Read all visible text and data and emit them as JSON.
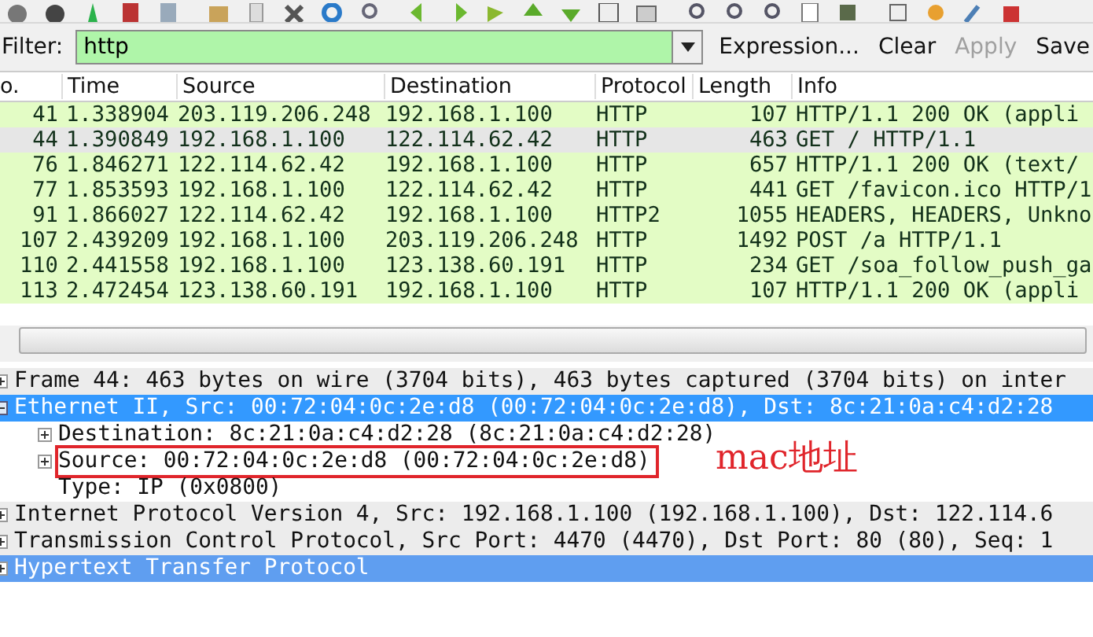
{
  "filter": {
    "label": "Filter:",
    "value": "http",
    "buttons": [
      {
        "label": "Expression...",
        "disabled": false
      },
      {
        "label": "Clear",
        "disabled": false
      },
      {
        "label": "Apply",
        "disabled": true
      },
      {
        "label": "Save",
        "disabled": false
      }
    ]
  },
  "packet_list": {
    "columns": [
      "o.",
      "Time",
      "Source",
      "Destination",
      "Protocol",
      "Length",
      "Info"
    ],
    "rows": [
      {
        "cells": [
          "41",
          "1.338904",
          "203.119.206.248",
          "192.168.1.100",
          "HTTP",
          "107",
          "HTTP/1.1 200 OK  (appli"
        ],
        "selected": false
      },
      {
        "cells": [
          "44",
          "1.390849",
          "192.168.1.100",
          "122.114.62.42",
          "HTTP",
          "463",
          "GET / HTTP/1.1"
        ],
        "selected": true
      },
      {
        "cells": [
          "76",
          "1.846271",
          "122.114.62.42",
          "192.168.1.100",
          "HTTP",
          "657",
          "HTTP/1.1 200 OK  (text/"
        ],
        "selected": false
      },
      {
        "cells": [
          "77",
          "1.853593",
          "192.168.1.100",
          "122.114.62.42",
          "HTTP",
          "441",
          "GET /favicon.ico HTTP/1"
        ],
        "selected": false
      },
      {
        "cells": [
          "91",
          "1.866027",
          "122.114.62.42",
          "192.168.1.100",
          "HTTP2",
          "1055",
          "HEADERS, HEADERS, Unkno"
        ],
        "selected": false
      },
      {
        "cells": [
          "107",
          "2.439209",
          "192.168.1.100",
          "203.119.206.248",
          "HTTP",
          "1492",
          "POST /a HTTP/1.1"
        ],
        "selected": false
      },
      {
        "cells": [
          "110",
          "2.441558",
          "192.168.1.100",
          "123.138.60.191",
          "HTTP",
          "234",
          "GET /soa_follow_push_ga"
        ],
        "selected": false
      },
      {
        "cells": [
          "113",
          "2.472454",
          "123.138.60.191",
          "192.168.1.100",
          "HTTP",
          "107",
          "HTTP/1.1 200 OK  (appli"
        ],
        "selected": false
      }
    ]
  },
  "details": [
    {
      "text": "Frame 44: 463 bytes on wire (3704 bits), 463 bytes captured (3704 bits) on inter",
      "expanded": false,
      "selected": false
    },
    {
      "text": "Ethernet II, Src: 00:72:04:0c:2e:d8 (00:72:04:0c:2e:d8), Dst: 8c:21:0a:c4:d2:28",
      "expanded": true,
      "selected": true,
      "children": [
        {
          "text": "Destination: 8c:21:0a:c4:d2:28 (8c:21:0a:c4:d2:28)",
          "expanded": false,
          "selected": false,
          "boxed": false,
          "expandable": true
        },
        {
          "text": "Source: 00:72:04:0c:2e:d8 (00:72:04:0c:2e:d8)",
          "expanded": false,
          "selected": false,
          "boxed": true,
          "expandable": true
        },
        {
          "text": "Type: IP (0x0800)",
          "selected": false,
          "boxed": false,
          "expandable": false
        }
      ]
    },
    {
      "text": "Internet Protocol Version 4, Src: 192.168.1.100 (192.168.1.100), Dst: 122.114.6",
      "expanded": false,
      "selected": false
    },
    {
      "text": "Transmission Control Protocol, Src Port: 4470 (4470), Dst Port: 80 (80), Seq: 1",
      "expanded": false,
      "selected": false
    },
    {
      "text": "Hypertext Transfer Protocol",
      "expanded": false,
      "selected": true
    }
  ],
  "annotation": {
    "text": "mac地址"
  }
}
